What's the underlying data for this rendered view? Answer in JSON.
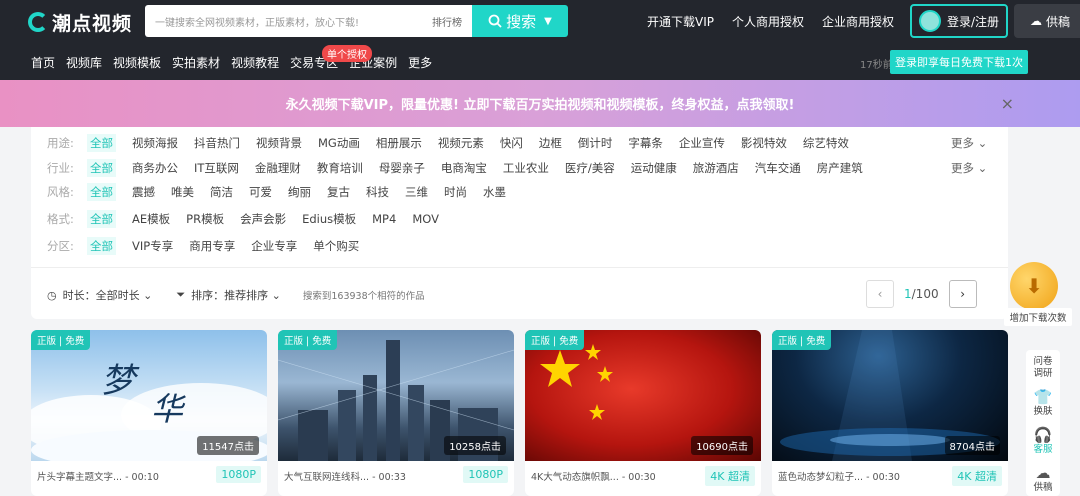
{
  "header": {
    "logo_text": "潮点视频",
    "search_placeholder": "一键搜索全网视频素材，正版素材，放心下载!",
    "rank_label": "排行榜",
    "search_label": "搜索",
    "links": [
      "开通下载VIP",
      "个人商用授权",
      "企业商用授权"
    ],
    "login_label": "登录/注册",
    "upload_label": "供稿",
    "tip": "登录即享每日免费下载1次",
    "nav": [
      "首页",
      "视频库",
      "视频模板",
      "实拍素材",
      "视频教程",
      "交易专区",
      "企业案例",
      "更多"
    ],
    "nav_badge": "单个授权",
    "nav_right": "17秒前"
  },
  "promo": {
    "text": "永久视频下载VIP，限量优惠! 立即下载百万实拍视频和视频模板，终身权益，点我领取!",
    "close": "×"
  },
  "filters": [
    {
      "label": "用途:",
      "options": [
        "全部",
        "视频海报",
        "抖音热门",
        "视频背景",
        "MG动画",
        "相册展示",
        "视频元素",
        "快闪",
        "边框",
        "倒计时",
        "字幕条",
        "企业宣传",
        "影视特效",
        "综艺特效"
      ],
      "more": "更多 ⌄"
    },
    {
      "label": "行业:",
      "options": [
        "全部",
        "商务办公",
        "IT互联网",
        "金融理财",
        "教育培训",
        "母婴亲子",
        "电商淘宝",
        "工业农业",
        "医疗/美容",
        "运动健康",
        "旅游酒店",
        "汽车交通",
        "房产建筑"
      ],
      "more": "更多 ⌄"
    },
    {
      "label": "风格:",
      "options": [
        "全部",
        "震撼",
        "唯美",
        "简洁",
        "可爱",
        "绚丽",
        "复古",
        "科技",
        "三维",
        "时尚",
        "水墨"
      ],
      "more": ""
    },
    {
      "label": "格式:",
      "options": [
        "全部",
        "AE模板",
        "PR模板",
        "会声会影",
        "Edius模板",
        "MP4",
        "MOV"
      ],
      "more": ""
    },
    {
      "label": "分区:",
      "options": [
        "全部",
        "VIP专享",
        "商用专享",
        "企业专享",
        "单个购买"
      ],
      "more": ""
    }
  ],
  "sortbar": {
    "duration": "时长：全部时长 ⌄",
    "sort": "排序：推荐排序 ⌄",
    "count": "搜索到163938个相符的作品"
  },
  "pager": {
    "current": "1",
    "total": "/100",
    "prev": "‹",
    "next": "›"
  },
  "side": {
    "coin_label": "增加下载次数",
    "items": [
      "问卷调研",
      "换肤",
      "客服",
      "供稿"
    ]
  },
  "cards": [
    {
      "tag": "正版 | 免费",
      "views": "11547点击",
      "title": "片头字幕主题文字... - 00:10",
      "quality": "1080P"
    },
    {
      "tag": "正版 | 免费",
      "views": "10258点击",
      "title": "大气互联网连线科... - 00:33",
      "quality": "1080P"
    },
    {
      "tag": "正版 | 免费",
      "views": "10690点击",
      "title": "4K大气动态旗帜飘... - 00:30",
      "quality": "4K 超清"
    },
    {
      "tag": "正版 | 免费",
      "views": "8704点击",
      "title": "蓝色动态梦幻粒子... - 00:30",
      "quality": "4K 超清"
    }
  ],
  "colors": {
    "accent": "#20d6c8",
    "header_bg": "#23262d"
  }
}
